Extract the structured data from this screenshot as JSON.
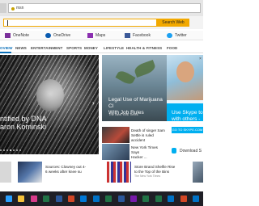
{
  "browser": {
    "address_text": "msn"
  },
  "search": {
    "button_label": "Search Web"
  },
  "apps": [
    {
      "label": "OneNote",
      "icon": "onenote-icon",
      "color": "#7a2f9a"
    },
    {
      "label": "OneDrive",
      "icon": "onedrive-icon",
      "color": "#0a5bb0"
    },
    {
      "label": "Maps",
      "icon": "maps-icon",
      "color": "#8b2fb0"
    },
    {
      "label": "Facebook",
      "icon": "facebook-icon",
      "color": "#3b5998"
    },
    {
      "label": "Twitter",
      "icon": "twitter-icon",
      "color": "#1da1f2"
    }
  ],
  "nav": [
    "OVIEW",
    "NEWS",
    "ENTERTAINMENT",
    "SPORTS",
    "MONEY",
    "LIFESTYLE",
    "HEALTH & FITNESS",
    "FOOD"
  ],
  "hero": {
    "title_line1": "ntified by DNA",
    "title_line2": "aron Kominski"
  },
  "tile2": {
    "title_line1": "Legal Use of Marijuana Cl",
    "title_line2": "With Job Rules",
    "source": "The New York Times"
  },
  "ad": {
    "line1": "Use Skype to",
    "line2": "with others -",
    "button": "GO TO SKYPE.COM",
    "close": "×",
    "download_label": "Download S"
  },
  "small_news": [
    {
      "text_line1": "Death of singer Sam",
      "text_line2": "Settle is ruled accident",
      "source": "The New York Times"
    },
    {
      "text_line1": "New York Times Says",
      "text_line2": "Hacker ...",
      "source": "USA Today"
    }
  ],
  "stories": [
    {
      "text_line1": "Sources: Clowney out 4-",
      "text_line2": "6 weeks after knee su",
      "source": ""
    },
    {
      "text_line1": "Store Brand Shelfie Rise",
      "text_line2": "to the Top of the Bins",
      "source": "The New York Times"
    }
  ],
  "taskbar": [
    {
      "icon": "windows-icon",
      "color": "#2aa0ff"
    },
    {
      "icon": "file-explorer-icon",
      "color": "#f5c23b"
    },
    {
      "icon": "store-icon",
      "color": "#d83b8a"
    },
    {
      "icon": "excel-icon",
      "color": "#217346"
    },
    {
      "icon": "word-icon",
      "color": "#2b579a"
    },
    {
      "icon": "powerpoint-icon",
      "color": "#d24726"
    },
    {
      "icon": "edge-icon",
      "color": "#0078d7"
    },
    {
      "icon": "outlook-icon",
      "color": "#0072c6"
    },
    {
      "icon": "excel-icon",
      "color": "#217346"
    },
    {
      "icon": "word-icon",
      "color": "#2b579a"
    },
    {
      "icon": "onenote-icon",
      "color": "#7719aa"
    },
    {
      "icon": "excel-icon",
      "color": "#217346"
    },
    {
      "icon": "excel-icon",
      "color": "#217346"
    },
    {
      "icon": "outlook-icon",
      "color": "#0072c6"
    },
    {
      "icon": "powerpoint-icon",
      "color": "#d24726"
    },
    {
      "icon": "outlook-icon",
      "color": "#0072c6"
    }
  ]
}
